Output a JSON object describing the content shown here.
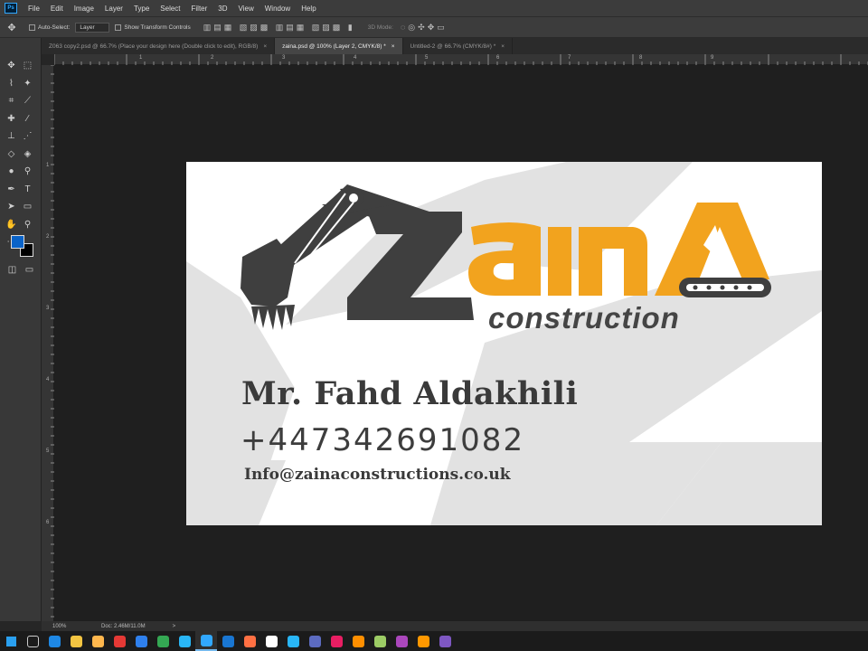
{
  "app": {
    "logo": "Ps",
    "menu": [
      "File",
      "Edit",
      "Image",
      "Layer",
      "Type",
      "Select",
      "Filter",
      "3D",
      "View",
      "Window",
      "Help"
    ]
  },
  "options": {
    "auto_select": "Auto-Select:",
    "layer_select": "Layer",
    "show_transform": "Show Transform Controls",
    "mode_3d": "3D Mode:"
  },
  "tabs": [
    {
      "label": "Z063 copy2.psd @ 66.7% (Place your design here (Double click to edit), RGB/8)",
      "close": "×"
    },
    {
      "label": "zaina.psd @ 100% (Layer 2, CMYK/8) *",
      "close": "×"
    },
    {
      "label": "Untitled-2 @ 66.7% (CMYK/8#) *",
      "close": "×"
    }
  ],
  "ruler": {
    "top_numbers": [
      "1",
      "2",
      "3",
      "4",
      "5",
      "6",
      "7",
      "8",
      "9"
    ],
    "left_numbers": [
      "1",
      "2",
      "3",
      "4",
      "5",
      "6"
    ]
  },
  "card": {
    "logo_construction": "construction",
    "name": "Mr. Fahd Aldakhili",
    "phone": "+447342691082",
    "email": "Info@zainaconstructions.co.uk"
  },
  "colors": {
    "accent": "#f2a31e",
    "dark": "#3f3f3f",
    "foreground_swatch": "#0a63c8",
    "background_swatch": "#000000"
  },
  "status": {
    "zoom": "100%",
    "doc": "Doc: 2.46M/11.0M",
    "arrow": ">"
  },
  "taskbar": [
    "windows-icon",
    "task-view-icon",
    "edge-icon",
    "file-explorer-icon",
    "store-icon",
    "app-red-icon",
    "dropbox-icon",
    "chrome-icon",
    "app-bolt-icon",
    "photoshop-icon",
    "mail-icon",
    "firefox-icon",
    "media-icon",
    "maps-icon",
    "app-blue-icon",
    "app-circle-icon",
    "vlc-icon",
    "notepad-icon",
    "app-purple-icon",
    "search-icon",
    "app-stripe-icon"
  ]
}
